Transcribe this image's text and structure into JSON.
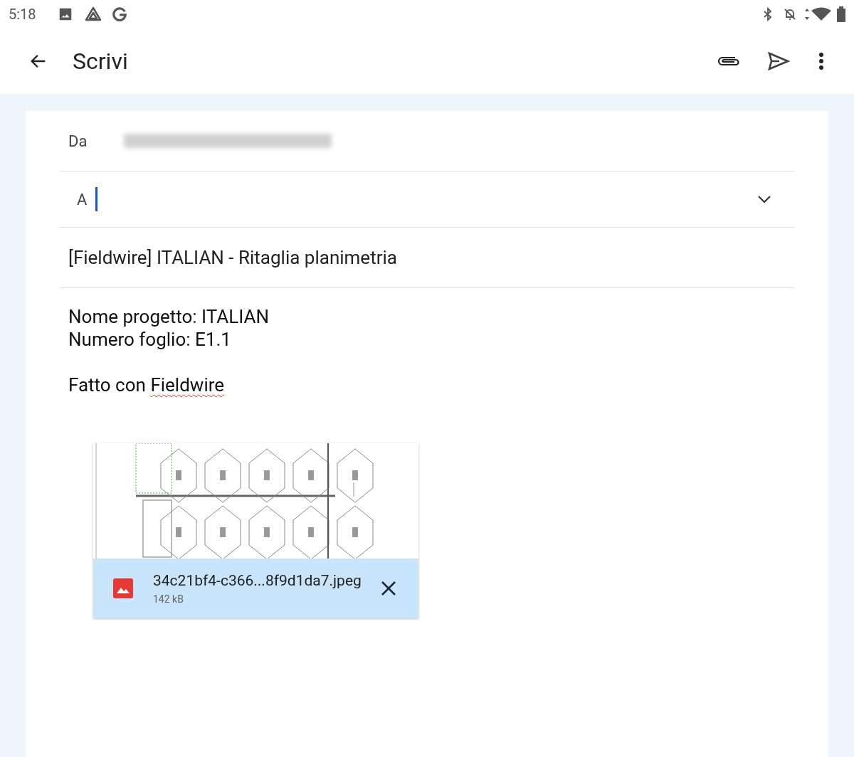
{
  "status_bar": {
    "time": "5:18"
  },
  "app_bar": {
    "title": "Scrivi"
  },
  "compose": {
    "from_label": "Da",
    "to_label": "A",
    "to_focused": true,
    "subject": "[Fieldwire] ITALIAN - Ritaglia planimetria",
    "paragraphs": [
      {
        "lines": [
          [
            {
              "text": "Nome progetto: ITALIAN",
              "misspelled": false
            }
          ],
          [
            {
              "text": "Numero foglio: E1.1",
              "misspelled": false
            }
          ]
        ]
      },
      {
        "lines": [
          [
            {
              "text": "Fatto con ",
              "misspelled": false
            },
            {
              "text": "Fieldwire",
              "misspelled": true
            }
          ]
        ]
      }
    ]
  },
  "attachment": {
    "kind": "picture",
    "file_name": "34c21bf4-c366...8f9d1da7.jpeg",
    "size": "142 kB"
  }
}
